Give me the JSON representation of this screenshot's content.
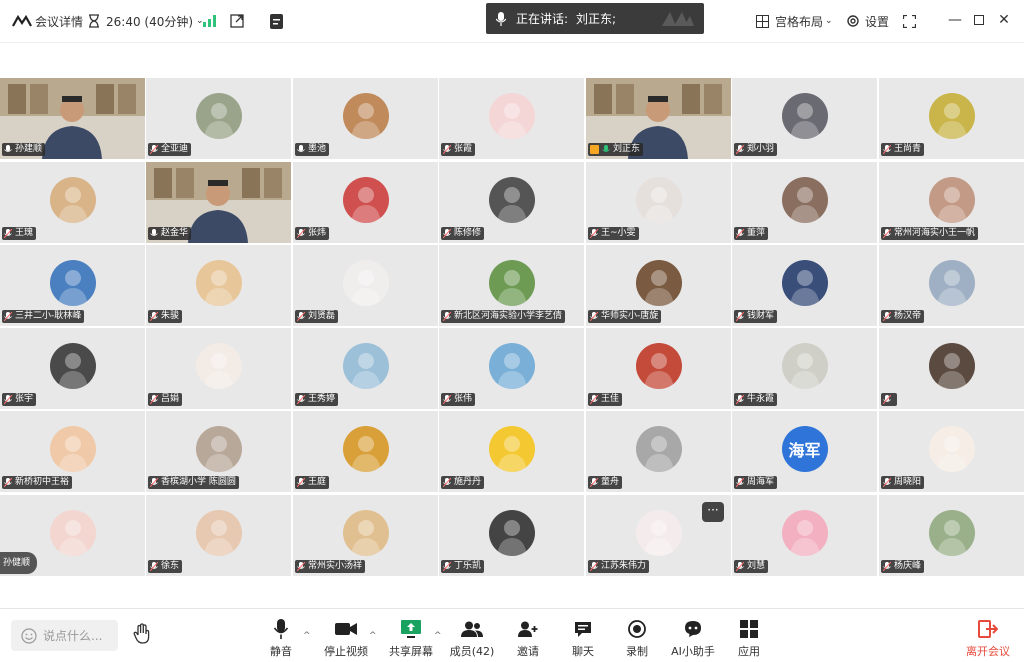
{
  "topbar": {
    "meeting_details": "会议详情",
    "timer": "26:40 (40分钟)",
    "speaking_label": "正在讲话:",
    "speaking_name": "刘正东;",
    "layout": "宫格布局",
    "settings": "设置"
  },
  "participants": [
    {
      "name": "孙建顺",
      "video": true,
      "mic": "muted"
    },
    {
      "name": "全亚迪",
      "color": "#9aa48a",
      "mic": "off"
    },
    {
      "name": "墨池",
      "color": "#c08a5b",
      "mic": "muted"
    },
    {
      "name": "张霞",
      "color": "#f5d6d6",
      "mic": "off"
    },
    {
      "name": "刘正东",
      "video": true,
      "active": true,
      "mic": "on"
    },
    {
      "name": "郑小羽",
      "color": "#6a6a72",
      "mic": "off"
    },
    {
      "name": "王尚青",
      "color": "#c9b54a",
      "mic": "off"
    },
    {
      "name": "王瑰",
      "color": "#d9b488",
      "mic": "off"
    },
    {
      "name": "赵金华",
      "video": true,
      "mic": "muted"
    },
    {
      "name": "张炜",
      "color": "#d05050",
      "mic": "off"
    },
    {
      "name": "陈修修",
      "color": "#555",
      "mic": "off"
    },
    {
      "name": "王~小雯",
      "color": "#e6e0dc",
      "mic": "off"
    },
    {
      "name": "董萍",
      "color": "#8a6f60",
      "mic": "off"
    },
    {
      "name": "常州河海实小王一帆",
      "color": "#c39a86",
      "mic": "off"
    },
    {
      "name": "三井二小-耿林峰",
      "color": "#4a7fc0",
      "mic": "off"
    },
    {
      "name": "朱骏",
      "color": "#e7c79a",
      "mic": "off"
    },
    {
      "name": "刘贤磊",
      "color": "#f0eded",
      "mic": "off"
    },
    {
      "name": "新北区河海实验小学李艺倩",
      "color": "#6e9b54",
      "mic": "off"
    },
    {
      "name": "华师实小-唐旋",
      "color": "#7a5a40",
      "mic": "off"
    },
    {
      "name": "钱财军",
      "color": "#3a4e7a",
      "mic": "off"
    },
    {
      "name": "杨汉帝",
      "color": "#9fb0c4",
      "mic": "off"
    },
    {
      "name": "张宇",
      "color": "#4a4a4a",
      "mic": "off"
    },
    {
      "name": "吕娟",
      "color": "#f3ebe6",
      "mic": "off"
    },
    {
      "name": "王秀婷",
      "color": "#9cc0d8",
      "mic": "off"
    },
    {
      "name": "张伟",
      "color": "#7ab0d8",
      "mic": "off"
    },
    {
      "name": "王佳",
      "color": "#c44a3a",
      "mic": "off"
    },
    {
      "name": "牛永霞",
      "color": "#cfcfc8",
      "mic": "off"
    },
    {
      "name": "",
      "color": "#5a4a40",
      "mic": "off"
    },
    {
      "name": "新桥初中王裕",
      "color": "#f0c9a8",
      "mic": "off"
    },
    {
      "name": "香槟湖小学 陈圆圆",
      "color": "#b8a89a",
      "mic": "off"
    },
    {
      "name": "王庭",
      "color": "#d9a03a",
      "mic": "off"
    },
    {
      "name": "施丹丹",
      "color": "#f3c830",
      "mic": "off"
    },
    {
      "name": "童舟",
      "color": "#a8a8a8",
      "mic": "off"
    },
    {
      "name": "周海军",
      "text": "海军",
      "color": "#2f74d8",
      "mic": "off"
    },
    {
      "name": "周晓阳",
      "color": "#f5ede6",
      "mic": "off"
    },
    {
      "name": "",
      "color": "#f2d6cf",
      "mic": "off"
    },
    {
      "name": "徐东",
      "color": "#e7c8b0",
      "mic": "off"
    },
    {
      "name": "常州实小汤祥",
      "color": "#e0c090",
      "mic": "off"
    },
    {
      "name": "丁乐凯",
      "color": "#444",
      "mic": "off"
    },
    {
      "name": "江苏朱伟力",
      "color": "#f4ecec",
      "mic": "off"
    },
    {
      "name": "刘慧",
      "color": "#f3b0c0",
      "mic": "off"
    },
    {
      "name": "杨庆峰",
      "color": "#9ab08a",
      "mic": "off"
    }
  ],
  "side_tag": "孙健顺",
  "bottom": {
    "chat_placeholder": "说点什么...",
    "buttons": {
      "mute": "静音",
      "video": "停止视频",
      "share": "共享屏幕",
      "members": "成员(42)",
      "invite": "邀请",
      "chat": "聊天",
      "record": "录制",
      "assistant": "AI小助手",
      "apps": "应用"
    },
    "leave": "离开会议"
  },
  "colors": {
    "active_border": "#2fc27a",
    "leave": "#e64a3b",
    "tile_bg": "#e8e8e8"
  }
}
